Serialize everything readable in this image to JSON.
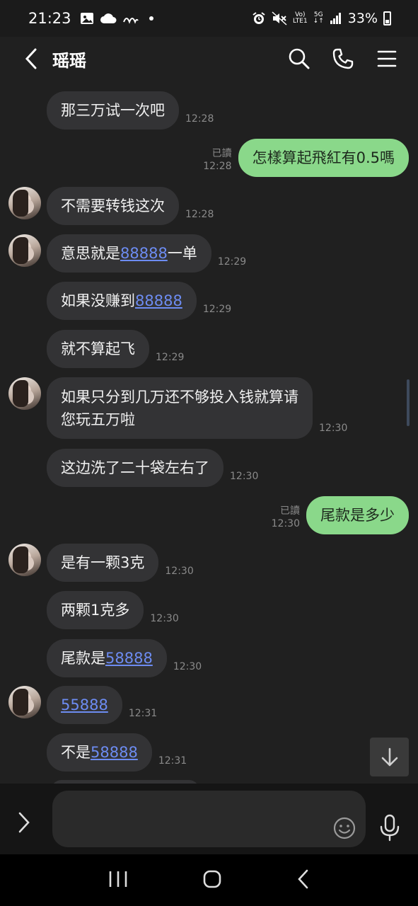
{
  "status_bar": {
    "time": "21:23",
    "network_label_top": "Vo)",
    "network_label_bottom": "LTE1",
    "network_type": "5G",
    "battery": "33%"
  },
  "header": {
    "contact_name": "瑶瑶"
  },
  "messages": [
    {
      "side": "in",
      "segments": [
        {
          "text": "那三万试一次吧",
          "link": false
        }
      ],
      "time": "12:28"
    },
    {
      "side": "out",
      "segments": [
        {
          "text": "怎樣算起飛紅有0.5嗎",
          "link": false
        }
      ],
      "read": "已讀",
      "time": "12:28"
    },
    {
      "side": "in",
      "segments": [
        {
          "text": "不需要转钱这次",
          "link": false
        }
      ],
      "time": "12:28"
    },
    {
      "side": "in",
      "segments": [
        {
          "text": "意思就是",
          "link": false
        },
        {
          "text": "88888",
          "link": true
        },
        {
          "text": "一单",
          "link": false
        }
      ],
      "time": "12:29"
    },
    {
      "side": "in",
      "segments": [
        {
          "text": "如果没赚到",
          "link": false
        },
        {
          "text": "88888",
          "link": true
        }
      ],
      "time": "12:29"
    },
    {
      "side": "in",
      "segments": [
        {
          "text": "就不算起飞",
          "link": false
        }
      ],
      "time": "12:29"
    },
    {
      "side": "in",
      "segments": [
        {
          "text": "如果只分到几万还不够投入钱就算请",
          "link": false
        }
      ],
      "segments2": [
        {
          "text": "您玩五万啦",
          "link": false
        }
      ],
      "time": "12:30"
    },
    {
      "side": "in",
      "segments": [
        {
          "text": "这边洗了二十袋左右了",
          "link": false
        }
      ],
      "time": "12:30"
    },
    {
      "side": "out",
      "segments": [
        {
          "text": "尾款是多少",
          "link": false
        }
      ],
      "read": "已讀",
      "time": "12:30"
    },
    {
      "side": "in",
      "segments": [
        {
          "text": "是有一颗3克",
          "link": false
        }
      ],
      "time": "12:30"
    },
    {
      "side": "in",
      "segments": [
        {
          "text": "两颗1克多",
          "link": false
        }
      ],
      "time": "12:30"
    },
    {
      "side": "in",
      "segments": [
        {
          "text": "尾款是",
          "link": false
        },
        {
          "text": "58888",
          "link": true
        }
      ],
      "time": "12:30"
    },
    {
      "side": "in",
      "segments": [
        {
          "text": "55888",
          "link": true
        }
      ],
      "time": "12:31"
    },
    {
      "side": "in",
      "segments": [
        {
          "text": "不是",
          "link": false
        },
        {
          "text": "58888",
          "link": true
        }
      ],
      "time": "12:31"
    }
  ],
  "input": {
    "placeholder": ""
  },
  "icons": {
    "back": "back-arrow-icon",
    "search": "search-icon",
    "call": "phone-icon",
    "menu": "menu-icon",
    "scroll_down": "arrow-down-icon",
    "expand": "chevron-right-icon",
    "emoji": "emoji-icon",
    "mic": "microphone-icon"
  },
  "colors": {
    "background": "#202020",
    "incoming_bubble": "#333335",
    "outgoing_bubble": "#8ad88a",
    "link": "#6d8cf2"
  }
}
